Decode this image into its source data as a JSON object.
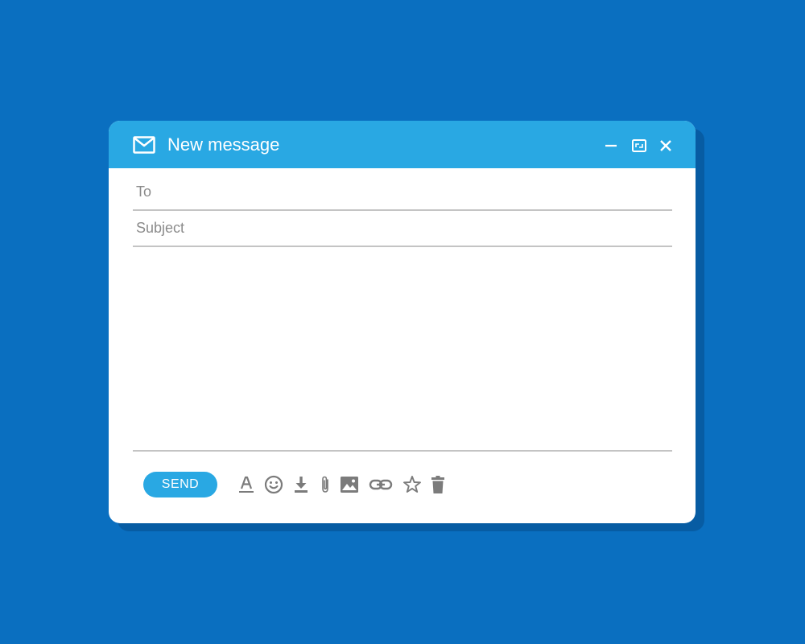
{
  "window": {
    "title": "New message",
    "title_icon": "envelope-icon",
    "controls": [
      "minimize-icon",
      "maximize-icon",
      "close-icon"
    ]
  },
  "compose": {
    "to": {
      "placeholder": "To",
      "value": ""
    },
    "subject": {
      "placeholder": "Subject",
      "value": ""
    },
    "body": {
      "value": ""
    }
  },
  "toolbar": {
    "send_label": "SEND",
    "icons": [
      "text-format-icon",
      "emoji-icon",
      "download-icon",
      "attachment-icon",
      "image-icon",
      "link-icon",
      "star-icon",
      "trash-icon"
    ]
  },
  "colors": {
    "background": "#0a6fc0",
    "titlebar": "#29a8e3",
    "accent": "#29a8e3",
    "icon_gray": "#7b7b7b",
    "divider": "#c4c4c4"
  }
}
